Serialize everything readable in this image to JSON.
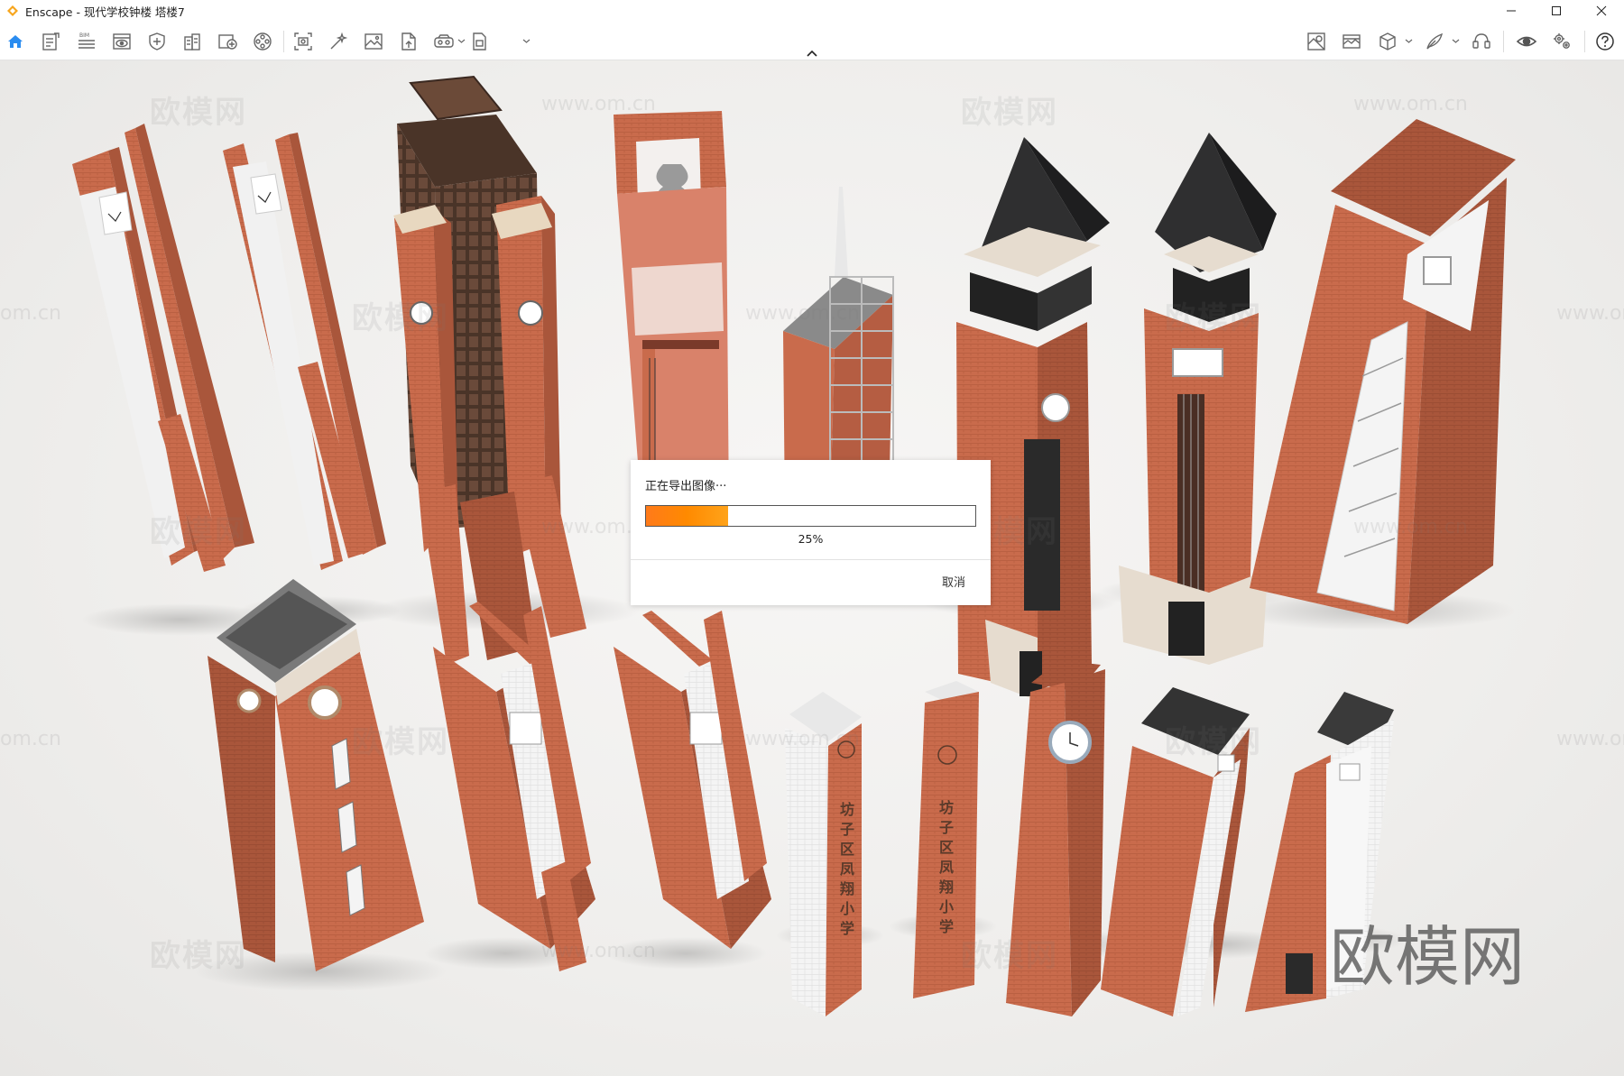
{
  "window": {
    "title": "Enscape - 现代学校钟楼 塔楼7",
    "controls": [
      "minimize-icon",
      "maximize-icon",
      "close-icon"
    ]
  },
  "toolbar": {
    "left_icons": [
      "home-icon",
      "document-icon",
      "bim-icon",
      "view-icon",
      "shield-icon",
      "building-icon",
      "image-add-icon",
      "film-reel-icon",
      "screenshot-icon",
      "magic-wand-icon",
      "image-icon",
      "file-export-icon",
      "vr-headset-icon",
      "export-icon"
    ],
    "right_icons": [
      "map-icon",
      "panorama-icon",
      "cube-icon",
      "feather-icon",
      "headset-icon",
      "eye-icon",
      "settings-icon",
      "help-icon"
    ]
  },
  "viewport": {
    "watermark_text": "欧模网",
    "watermark_url": "www.om.cn",
    "watermark_url_partial": "om.cn",
    "brand_watermark": "欧模网",
    "tower_sign_1": "坊子区凤翔小学",
    "tower_sign_2": "坊子区凤翔小学"
  },
  "export_dialog": {
    "title": "正在导出图像···",
    "progress_percent": 25,
    "progress_label": "25%",
    "cancel_label": "取消",
    "progress_color": "#ff8a00"
  },
  "colors": {
    "brick": "#c96b4c",
    "brick_dark": "#a8553a",
    "roof": "#2f2f30",
    "accent": "#1e90ff"
  }
}
